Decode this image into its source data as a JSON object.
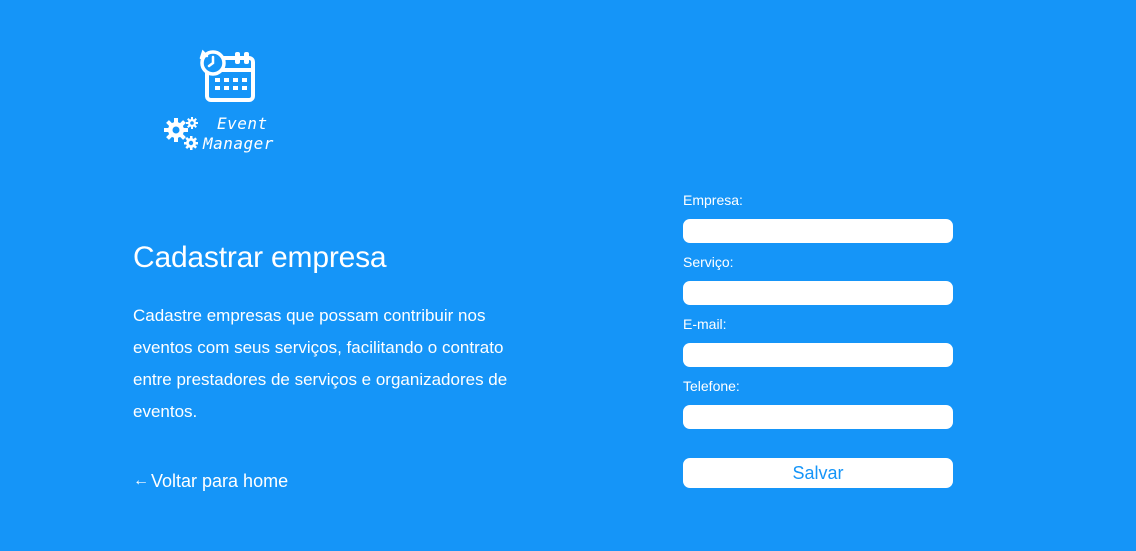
{
  "logo": {
    "line1": "Event",
    "line2": "Manager",
    "icons": [
      "calendar-clock-icon",
      "gears-icon"
    ]
  },
  "main": {
    "title": "Cadastrar empresa",
    "description": "Cadastre empresas que possam contribuir nos eventos com seus serviços, facilitando o contrato entre prestadores de serviços e organizadores de eventos.",
    "back_arrow": "←",
    "back_link": "Voltar para home"
  },
  "form": {
    "fields": [
      {
        "label": "Empresa:",
        "value": "",
        "placeholder": ""
      },
      {
        "label": "Serviço:",
        "value": "",
        "placeholder": ""
      },
      {
        "label": "E-mail:",
        "value": "",
        "placeholder": ""
      },
      {
        "label": "Telefone:",
        "value": "",
        "placeholder": ""
      }
    ],
    "submit_label": "Salvar"
  },
  "colors": {
    "background": "#1595f8",
    "text": "#ffffff",
    "button_text": "#1595f8"
  }
}
